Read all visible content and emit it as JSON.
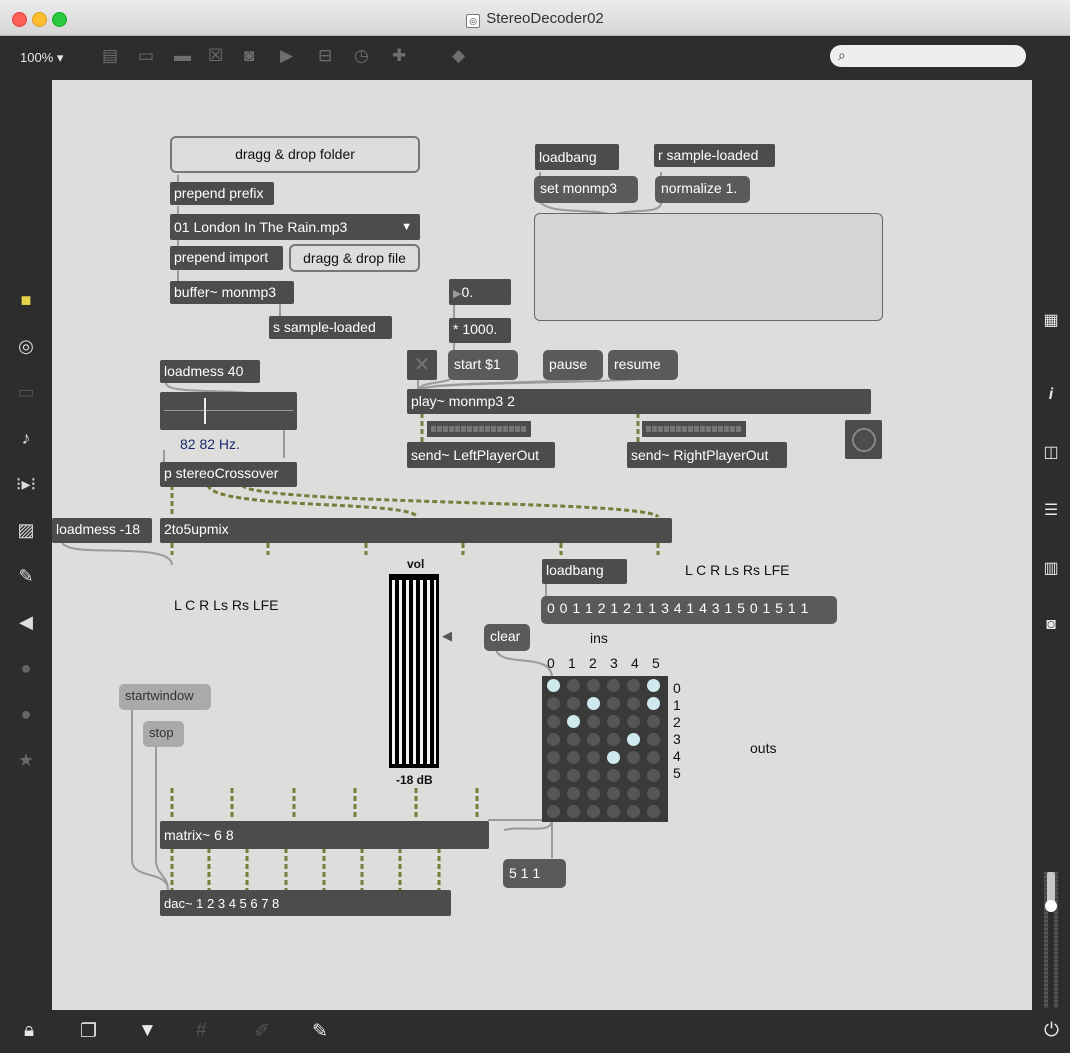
{
  "window": {
    "title": "StereoDecoder02",
    "zoom": "100% ▾"
  },
  "toolbar": {
    "icons": [
      "presentation-icon",
      "comment-icon",
      "message-icon",
      "toggle-icon",
      "button-icon",
      "number-icon",
      "slider-icon",
      "dial-icon",
      "plus-icon",
      "paint-bucket-icon"
    ]
  },
  "left_sidebar": {
    "icons": [
      "cube-icon",
      "target-icon",
      "film-icon",
      "music-note-icon",
      "sequence-icon",
      "image-icon",
      "paperclip-icon",
      "plug-icon",
      "vimeo-icon",
      "beatport-icon",
      "star-icon"
    ]
  },
  "right_sidebar": {
    "icons": [
      "grid-icon",
      "info-icon",
      "columns-icon",
      "list-icon",
      "book-icon",
      "camera-icon"
    ]
  },
  "bottom_bar": {
    "icons": [
      "lock-icon",
      "windows-icon",
      "presentation-mode-icon",
      "grid-icon",
      "snap-icon",
      "wrench-icon",
      "power-icon"
    ]
  },
  "patch": {
    "dragg_folder": "dragg & drop folder",
    "prepend_prefix": "prepend prefix",
    "umenu_value": "01 London In The Rain.mp3",
    "prepend_import": "prepend import",
    "dragg_file": "dragg & drop file",
    "buffer": "buffer~ monmp3",
    "s_sample": "s sample-loaded",
    "loadbang1": "loadbang",
    "r_sample": "r sample-loaded",
    "set_msg": "set monmp3",
    "normalize": "normalize 1.",
    "flonum": "0.",
    "times": "* 1000.",
    "start": "start $1",
    "pause": "pause",
    "resume": "resume",
    "play": "play~ monmp3 2",
    "send_left": "send~ LeftPlayerOut",
    "send_right": "send~ RightPlayerOut",
    "loadmess40": "loadmess 40",
    "hz": "82 82 Hz.",
    "crossover": "p stereoCrossover",
    "loadmess18": "loadmess -18",
    "upmix": "2to5upmix",
    "vol_label": "vol",
    "db_label": "-18 dB",
    "channels_left": "L C R Ls Rs LFE",
    "channels_right": "L C R Ls Rs LFE",
    "loadbang2": "loadbang",
    "matrix_list": "0 0 1 1 2 1 2 1 1 3 4 1 4 3 1 5 0 1 5 1 1",
    "clear": "clear",
    "ins": "ins",
    "outs": "outs",
    "col_labels": [
      "0",
      "1",
      "2",
      "3",
      "4",
      "5"
    ],
    "row_labels": [
      "0",
      "1",
      "2",
      "3",
      "4",
      "5"
    ],
    "startwindow": "startwindow",
    "stop": "stop",
    "matrix": "matrix~ 6 8",
    "dac": "dac~ 1 2 3 4 5 6 7 8",
    "matrix_out": "5 1 1"
  }
}
